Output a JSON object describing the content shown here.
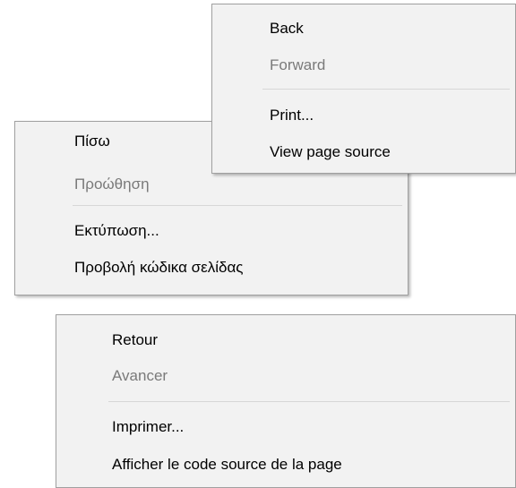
{
  "menus": {
    "en": {
      "items": [
        {
          "label": "Back",
          "enabled": true
        },
        {
          "label": "Forward",
          "enabled": false
        },
        {
          "label": "Print...",
          "enabled": true
        },
        {
          "label": "View page source",
          "enabled": true
        }
      ]
    },
    "el": {
      "items": [
        {
          "label": "Πίσω",
          "enabled": true
        },
        {
          "label": "Προώθηση",
          "enabled": false
        },
        {
          "label": "Εκτύπωση...",
          "enabled": true
        },
        {
          "label": "Προβολή κώδικα σελίδας",
          "enabled": true
        }
      ]
    },
    "fr": {
      "items": [
        {
          "label": "Retour",
          "enabled": true
        },
        {
          "label": "Avancer",
          "enabled": false
        },
        {
          "label": "Imprimer...",
          "enabled": true
        },
        {
          "label": "Afficher le code source de la page",
          "enabled": true
        }
      ]
    }
  },
  "colors": {
    "menu_background": "#f2f2f2",
    "menu_border": "#a0a0a0",
    "enabled_text": "#000000",
    "disabled_text": "#7a7a7a",
    "separator": "#d7d7d7"
  }
}
